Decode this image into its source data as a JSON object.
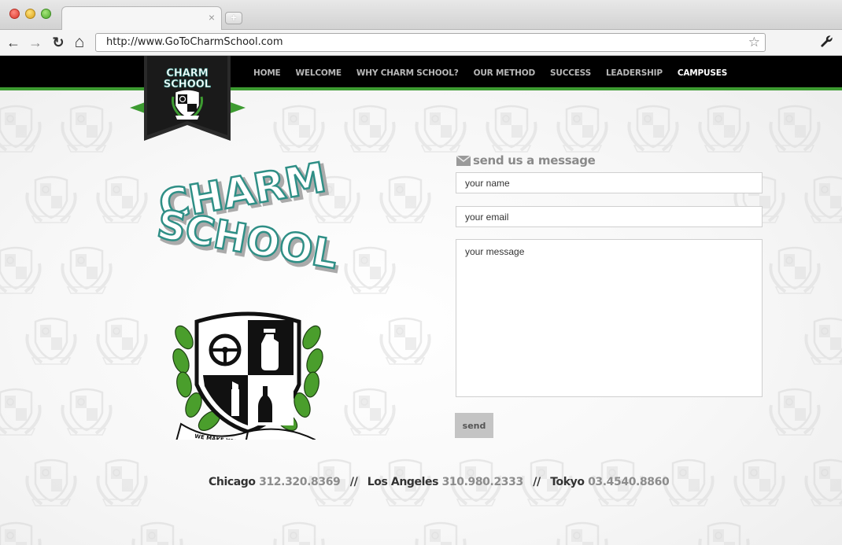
{
  "browser": {
    "url": "http://www.GoToCharmSchool.com",
    "tab_close": "×",
    "new_tab": "+",
    "back_icon": "←",
    "forward_icon": "→",
    "reload_icon": "↻",
    "home_icon": "⌂",
    "star_icon": "☆",
    "wrench_icon": "🔧"
  },
  "nav": {
    "items": [
      {
        "label": "HOME"
      },
      {
        "label": "WELCOME"
      },
      {
        "label": "WHY CHARM SCHOOL?"
      },
      {
        "label": "OUR METHOD"
      },
      {
        "label": "SUCCESS"
      },
      {
        "label": "LEADERSHIP"
      },
      {
        "label": "CAMPUSES"
      }
    ],
    "active": "CAMPUSES"
  },
  "logo": {
    "line1": "CHARM",
    "line2": "SCHOOL",
    "banner": "WE MAKE YOUR BRAND IRRESISTIBLE"
  },
  "form": {
    "title": "send us a message",
    "name_placeholder": "your name",
    "email_placeholder": "your email",
    "message_placeholder": "your message",
    "send_label": "send"
  },
  "contacts": {
    "chicago_city": "Chicago",
    "chicago_phone": "312.320.8369",
    "la_city": "Los Angeles",
    "la_phone": "310.980.2333",
    "tokyo_city": "Tokyo",
    "tokyo_phone": "03.4540.8860",
    "separator": "//"
  },
  "colors": {
    "brand_green": "#3d9b31",
    "brand_teal": "#2f8f86",
    "nav_bg": "#000000"
  }
}
